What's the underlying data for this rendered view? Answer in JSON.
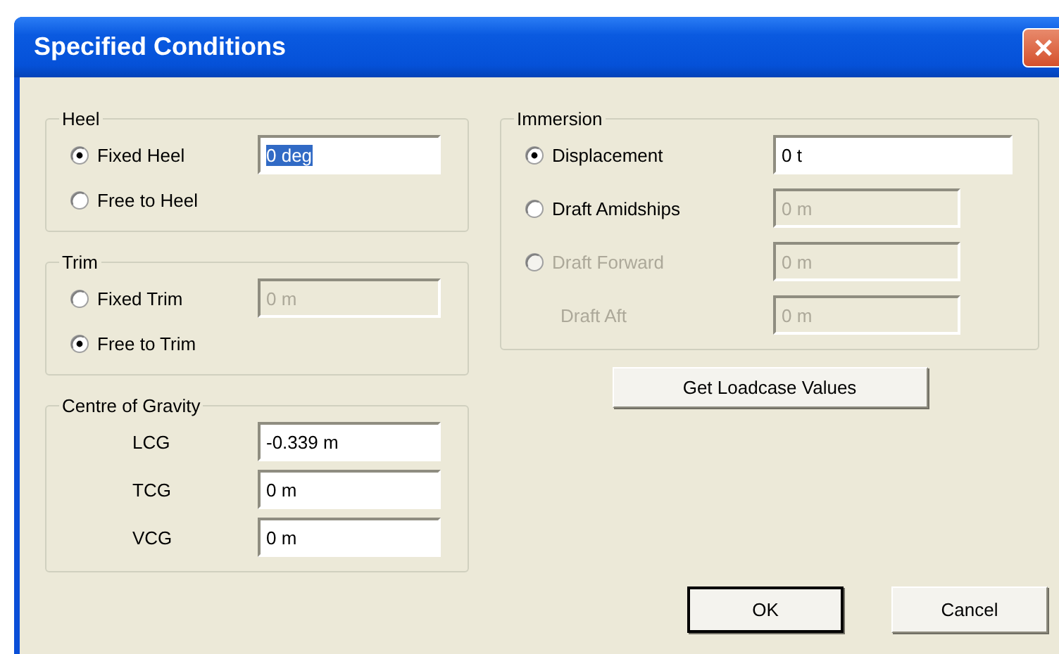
{
  "window": {
    "title": "Specified Conditions"
  },
  "groups_left": [
    {
      "label": "Heel",
      "rows": [
        {
          "kind": "radio",
          "label": "Fixed Heel",
          "selected": true,
          "disabled": false,
          "field": {
            "value": "0 deg",
            "disabled": false,
            "text_selected": true
          }
        },
        {
          "kind": "radio",
          "label": "Free to Heel",
          "selected": false,
          "disabled": false
        }
      ]
    },
    {
      "label": "Trim",
      "rows": [
        {
          "kind": "radio",
          "label": "Fixed Trim",
          "selected": false,
          "disabled": false,
          "field": {
            "value": "0 m",
            "disabled": true,
            "text_selected": false
          }
        },
        {
          "kind": "radio",
          "label": "Free to Trim",
          "selected": true,
          "disabled": false
        }
      ]
    },
    {
      "label": "Centre of Gravity",
      "rows": [
        {
          "kind": "label",
          "label": "LCG",
          "disabled": false,
          "field": {
            "value": "-0.339 m",
            "disabled": false,
            "text_selected": false
          }
        },
        {
          "kind": "label",
          "label": "TCG",
          "disabled": false,
          "field": {
            "value": "0 m",
            "disabled": false,
            "text_selected": false
          }
        },
        {
          "kind": "label",
          "label": "VCG",
          "disabled": false,
          "field": {
            "value": "0 m",
            "disabled": false,
            "text_selected": false
          }
        }
      ]
    }
  ],
  "immersion": {
    "label": "Immersion",
    "rows": [
      {
        "kind": "radio",
        "label": "Displacement",
        "selected": true,
        "disabled": false,
        "field": {
          "value": "0 t",
          "disabled": false,
          "text_selected": false
        }
      },
      {
        "kind": "radio",
        "label": "Draft Amidships",
        "selected": false,
        "disabled": false,
        "field": {
          "value": "0 m",
          "disabled": true,
          "text_selected": false
        }
      },
      {
        "kind": "radio",
        "label": "Draft Forward",
        "selected": false,
        "disabled": true,
        "field": {
          "value": "0 m",
          "disabled": true,
          "text_selected": false
        }
      },
      {
        "kind": "label",
        "label": "Draft Aft",
        "disabled": true,
        "field": {
          "value": "0 m",
          "disabled": true,
          "text_selected": false
        }
      }
    ]
  },
  "loadcase_button": "Get Loadcase Values",
  "buttons": [
    {
      "label": "OK",
      "default": true
    },
    {
      "label": "Cancel",
      "default": false
    }
  ]
}
